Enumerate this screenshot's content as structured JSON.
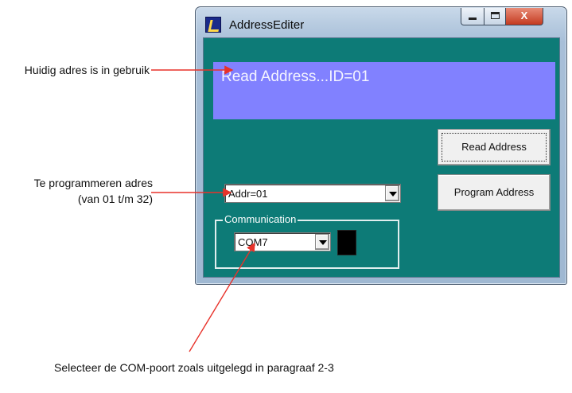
{
  "window": {
    "title": "AddressEditer",
    "app_icon": "app-icon",
    "controls": {
      "minimize": "minimize-icon",
      "maximize": "maximize-icon",
      "close_label": "X"
    }
  },
  "display": {
    "text": "Read Address...ID=01"
  },
  "buttons": {
    "read_address": "Read Address",
    "program_address": "Program Address"
  },
  "address_select": {
    "value": "Addr=01"
  },
  "communication": {
    "label": "Communication",
    "port_value": "COM7"
  },
  "annotations": {
    "current_address": "Huidig adres is in gebruik",
    "program_address": "Te programmeren adres (van 01 t/m 32)",
    "com_port": "Selecteer de COM-poort zoals uitgelegd in paragraaf 2-3"
  },
  "colors": {
    "client_bg": "#0d7b77",
    "display_bg": "#8181ff",
    "arrow": "#e8322a"
  }
}
